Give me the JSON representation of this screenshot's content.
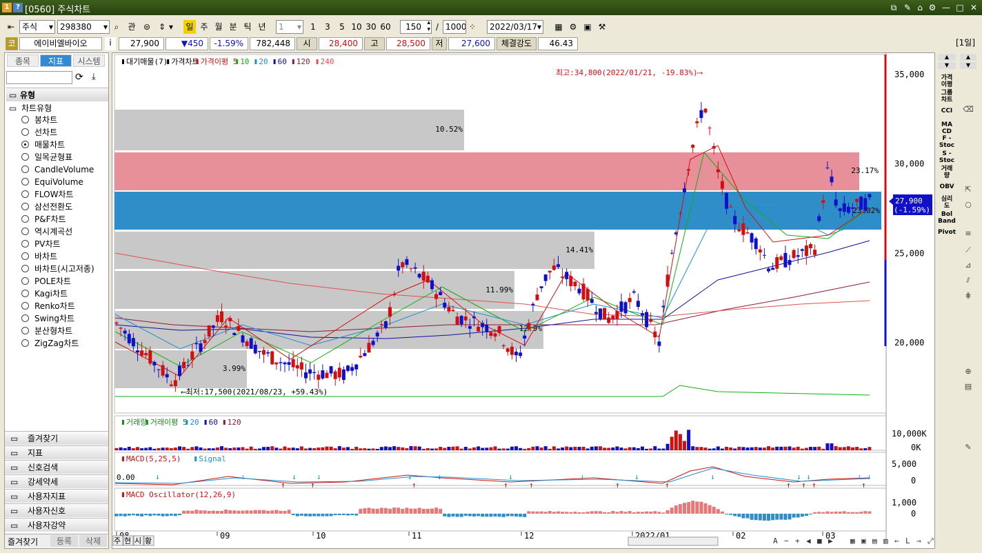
{
  "window": {
    "title": "[0560] 주식차트",
    "sys_icons": [
      "1",
      "?"
    ],
    "controls": [
      "⧉",
      "✎",
      "⌂",
      "⚙",
      "—",
      "□",
      "✕"
    ]
  },
  "toolbar": {
    "market": "주식",
    "code": "298380",
    "btn_gwan": "관",
    "periods": [
      "일",
      "주",
      "월",
      "분",
      "틱",
      "년"
    ],
    "period_active": "일",
    "interval_value": "1",
    "quick": [
      "1",
      "3",
      "5",
      "10",
      "30",
      "60"
    ],
    "count": "150",
    "slash": "/",
    "total": "1000",
    "date": "2022/03/17"
  },
  "quote": {
    "badge": "코",
    "name": "에이비엘바이오",
    "info": "i",
    "price": "27,900",
    "change": "▼450",
    "change_pct": "-1.59%",
    "volume": "782,448",
    "open_label": "시",
    "open": "28,400",
    "high_label": "고",
    "high": "28,500",
    "low_label": "저",
    "low": "27,600",
    "strength_label": "체결강도",
    "strength": "46.43",
    "period_tag": "[1일]"
  },
  "sidebar": {
    "tabs": [
      "종목",
      "지표",
      "시스템"
    ],
    "tab_active": "지표",
    "section": "유형",
    "category": "차트유형",
    "items": [
      "봉차트",
      "선차트",
      "매물차트",
      "일목균형표",
      "CandleVolume",
      "EquiVolume",
      "FLOW차트",
      "삼선전환도",
      "P&F차트",
      "역시계곡선",
      "PV차트",
      "바차트",
      "바차트(시고저종)",
      "POLE차트",
      "Kagi차트",
      "Renko차트",
      "Swing차트",
      "분산형차트",
      "ZigZag차트"
    ],
    "selected": "매물차트",
    "bottom_sections": [
      "즐겨찾기",
      "지표",
      "신호검색",
      "강세약세",
      "사용자지표",
      "사용자신호",
      "사용자강약"
    ],
    "footer": [
      "즐겨찾기",
      "등록",
      "삭제"
    ]
  },
  "chart": {
    "price_legend": [
      {
        "t": "대기매물(7)",
        "c": "#000000"
      },
      {
        "t": "가격차트",
        "c": "#000000"
      },
      {
        "t": "가격이평 5",
        "c": "#d01010"
      },
      {
        "t": "10",
        "c": "#10b010"
      },
      {
        "t": "20",
        "c": "#1f8fd0"
      },
      {
        "t": "60",
        "c": "#1010a0"
      },
      {
        "t": "120",
        "c": "#8b1a3a"
      },
      {
        "t": "240",
        "c": "#e05050"
      }
    ],
    "price_axis": [
      "35,000",
      "30,000",
      "25,000",
      "20,000"
    ],
    "current_price": "27,900",
    "current_pct": "(-1.59%)",
    "high_note": "최고:34,800(2022/01/21, -19.83%)⟶",
    "low_note": "⟵최저:17,500(2021/08/23, +59.43%)",
    "volume_profile_pct": [
      "10.52%",
      "23.17%",
      "23.02%",
      "14.41%",
      "11.99%",
      "12.9%",
      "3.99%"
    ],
    "vol_legend": [
      {
        "t": "거래량",
        "c": "#1a8a1a"
      },
      {
        "t": "거래이평 5",
        "c": "#1a8a1a"
      },
      {
        "t": "20",
        "c": "#1f8fd0"
      },
      {
        "t": "60",
        "c": "#1010a0"
      },
      {
        "t": "120",
        "c": "#8b1a3a"
      }
    ],
    "vol_axis": [
      "10,000K",
      "0K"
    ],
    "macd_legend": [
      {
        "t": "MACD(5,25,5)",
        "c": "#d01010"
      },
      {
        "t": "Signal",
        "c": "#1f8fd0"
      }
    ],
    "macd_axis": [
      "5,000",
      "0"
    ],
    "macd_zero_label": "0.00",
    "osc_legend": [
      {
        "t": "MACD Oscillator(12,26,9)",
        "c": "#d01010"
      }
    ],
    "osc_axis": [
      "1,000",
      "0"
    ],
    "x_labels": [
      "08",
      "09",
      "10",
      "11",
      "12",
      "2022/01",
      "02",
      "03"
    ],
    "bottom_tabs": [
      "주",
      "현",
      "시",
      "황"
    ]
  },
  "colors": {
    "up": "#d01010",
    "down": "#1010c8",
    "pink_band": "#e8909a",
    "blue_band": "#2f8ec8",
    "gray_band": "#c8c8c8"
  }
}
